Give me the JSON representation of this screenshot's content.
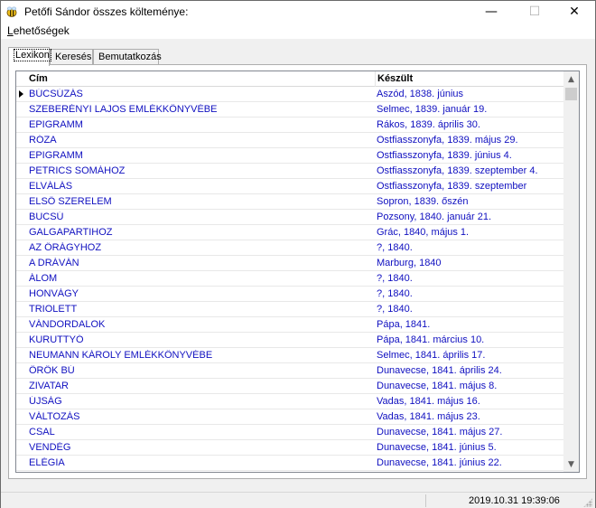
{
  "window": {
    "title": "Petőfi Sándor összes költeménye:",
    "minimize_glyph": "—",
    "maximize_glyph": "☐",
    "close_glyph": "✕",
    "icon": "bee-icon"
  },
  "menu": {
    "items": [
      {
        "label_underlined": "L",
        "label_rest": "ehetőségek"
      }
    ]
  },
  "tabs": [
    {
      "label": "Lexikon",
      "active": true
    },
    {
      "label": "Keresés",
      "active": false
    },
    {
      "label": "Bemutatkozás",
      "active": false
    }
  ],
  "grid": {
    "columns": [
      "Cím",
      "Készült"
    ],
    "rows": [
      {
        "cim": "BÚCSÚZÁS",
        "keszult": "Aszód, 1838. június",
        "current": true
      },
      {
        "cim": "SZEBERÉNYI LAJOS EMLÉKKÖNYVÉBE",
        "keszult": "Selmec, 1839. január 19."
      },
      {
        "cim": "EPIGRAMM",
        "keszult": "Rákos, 1839. április 30."
      },
      {
        "cim": "RÓZA",
        "keszult": "Ostfiasszonyfa, 1839. május 29."
      },
      {
        "cim": "EPIGRAMM",
        "keszult": "Ostfiasszonyfa, 1839. június 4."
      },
      {
        "cim": "PETRICS SOMÁHOZ",
        "keszult": "Ostfiasszonyfa, 1839. szeptember 4."
      },
      {
        "cim": "ELVÁLÁS",
        "keszult": "Ostfiasszonyfa, 1839. szeptember"
      },
      {
        "cim": "ELSŐ SZERELEM",
        "keszult": "Sopron, 1839. őszén"
      },
      {
        "cim": "BUCSÚ",
        "keszult": "Pozsony, 1840. január 21."
      },
      {
        "cim": "GALGAPARTIHOZ",
        "keszult": "Grác, 1840, május 1."
      },
      {
        "cim": "AZ ŐRÁGYHOZ",
        "keszult": "?, 1840."
      },
      {
        "cim": "A DRÁVÁN",
        "keszult": "Marburg, 1840"
      },
      {
        "cim": "ÁLOM",
        "keszult": "?, 1840."
      },
      {
        "cim": "HONVÁGY",
        "keszult": "?, 1840."
      },
      {
        "cim": "TRIOLETT",
        "keszult": "?, 1840."
      },
      {
        "cim": "VÁNDORDALOK",
        "keszult": "Pápa, 1841."
      },
      {
        "cim": "KURUTTYÓ",
        "keszult": "Pápa, 1841. március 10."
      },
      {
        "cim": "NEUMANN KÁROLY EMLÉKKÖNYVÉBE",
        "keszult": "Selmec, 1841. április 17."
      },
      {
        "cim": "ÖRÖK BÚ",
        "keszult": "Dunavecse, 1841. április 24."
      },
      {
        "cim": "ZIVATAR",
        "keszult": "Dunavecse, 1841. május 8."
      },
      {
        "cim": "ÚJSÁG",
        "keszult": "Vadas, 1841. május 16."
      },
      {
        "cim": "VÁLTOZÁS",
        "keszult": "Vadas, 1841. május 23."
      },
      {
        "cim": "CSAL",
        "keszult": "Dunavecse, 1841. május 27."
      },
      {
        "cim": "VENDÉG",
        "keszult": "Dunavecse, 1841. június 5."
      },
      {
        "cim": "ELÉGIA",
        "keszult": "Dunavecse, 1841. június 22."
      }
    ]
  },
  "statusbar": {
    "datetime": "2019.10.31 19:39:06"
  },
  "colors": {
    "row_text": "#1010c0",
    "window_bg": "#f0f0f0"
  }
}
